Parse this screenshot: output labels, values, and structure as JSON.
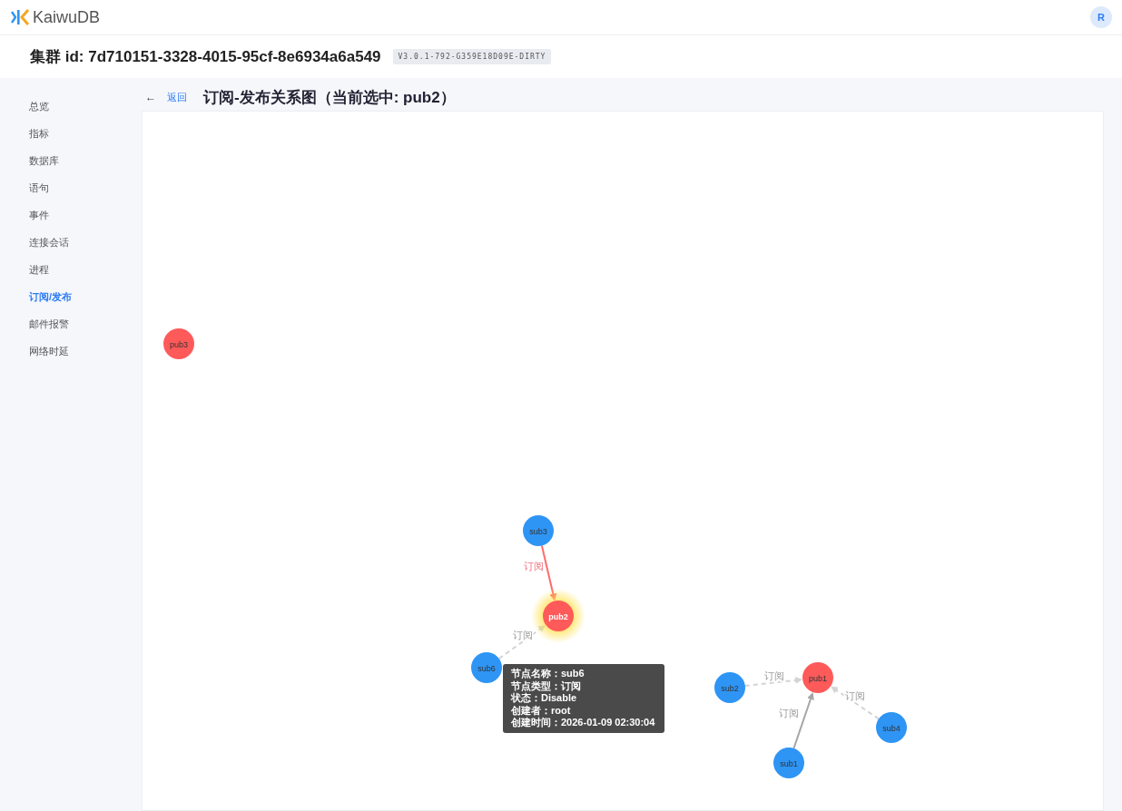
{
  "header": {
    "logo": "KaiwuDB",
    "avatar": "R"
  },
  "cluster": {
    "title": "集群 id: 7d710151-3328-4015-95cf-8e6934a6a549",
    "version": "V3.0.1-792-G359E18D09E-DIRTY"
  },
  "sidebar": {
    "items": [
      {
        "label": "总览",
        "selected": false
      },
      {
        "label": "指标",
        "selected": false
      },
      {
        "label": "数据库",
        "selected": false
      },
      {
        "label": "语句",
        "selected": false
      },
      {
        "label": "事件",
        "selected": false
      },
      {
        "label": "连接会话",
        "selected": false
      },
      {
        "label": "进程",
        "selected": false
      },
      {
        "label": "订阅/发布",
        "selected": true
      },
      {
        "label": "邮件报警",
        "selected": false
      },
      {
        "label": "网络时延",
        "selected": false
      }
    ]
  },
  "page": {
    "back_icon": "←",
    "back": "返回",
    "title": "订阅-发布关系图（当前选中: pub2）"
  },
  "graph": {
    "nodes": [
      {
        "name": "pub3",
        "kind": "pub",
        "selected": false
      },
      {
        "name": "sub3",
        "kind": "sub",
        "selected": false
      },
      {
        "name": "pub2",
        "kind": "pub",
        "selected": true
      },
      {
        "name": "sub6",
        "kind": "sub",
        "selected": false
      },
      {
        "name": "sub2",
        "kind": "sub",
        "selected": false
      },
      {
        "name": "pub1",
        "kind": "pub",
        "selected": false
      },
      {
        "name": "sub4",
        "kind": "sub",
        "selected": false
      },
      {
        "name": "sub1",
        "kind": "sub",
        "selected": false
      }
    ],
    "edges": [
      {
        "label": "订阅",
        "active": true,
        "highlighted": true
      },
      {
        "label": "订阅",
        "active": false,
        "highlighted": false
      },
      {
        "label": "订阅",
        "active": false,
        "highlighted": false
      },
      {
        "label": "订阅",
        "active": true,
        "highlighted": false
      },
      {
        "label": "订阅",
        "active": false,
        "highlighted": false
      }
    ],
    "tooltip": {
      "lines": [
        "节点名称：sub6",
        "节点类型：订阅",
        "状态：Disable",
        "创建者：root",
        "创建时间：2026-01-09 02:30:04"
      ]
    }
  }
}
